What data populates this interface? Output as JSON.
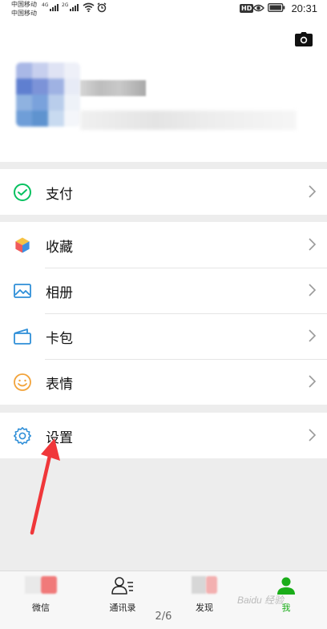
{
  "status_bar": {
    "carrier_1": "中国移动",
    "carrier_2": "中国移动",
    "signal_1_tag": "4G",
    "signal_2_tag": "2G",
    "hd": "HD",
    "time": "20:31"
  },
  "menu": {
    "pay": {
      "label": "支付",
      "icon": "wechat-pay-icon"
    },
    "favorites": {
      "label": "收藏",
      "icon": "cube-icon"
    },
    "album": {
      "label": "相册",
      "icon": "image-icon"
    },
    "cards": {
      "label": "卡包",
      "icon": "wallet-icon"
    },
    "stickers": {
      "label": "表情",
      "icon": "smiley-icon"
    },
    "settings": {
      "label": "设置",
      "icon": "gear-icon"
    }
  },
  "bottom_nav": {
    "chats": "微信",
    "contacts": "通讯录",
    "discover": "发现",
    "me": "我"
  },
  "page_indicator": "2/6",
  "watermark": "Baidu 经验",
  "colors": {
    "green": "#1aad19",
    "pay_green": "#07c160",
    "blue": "#2f8fd8",
    "orange": "#f2a33a",
    "annotation_red": "#f0373a"
  }
}
